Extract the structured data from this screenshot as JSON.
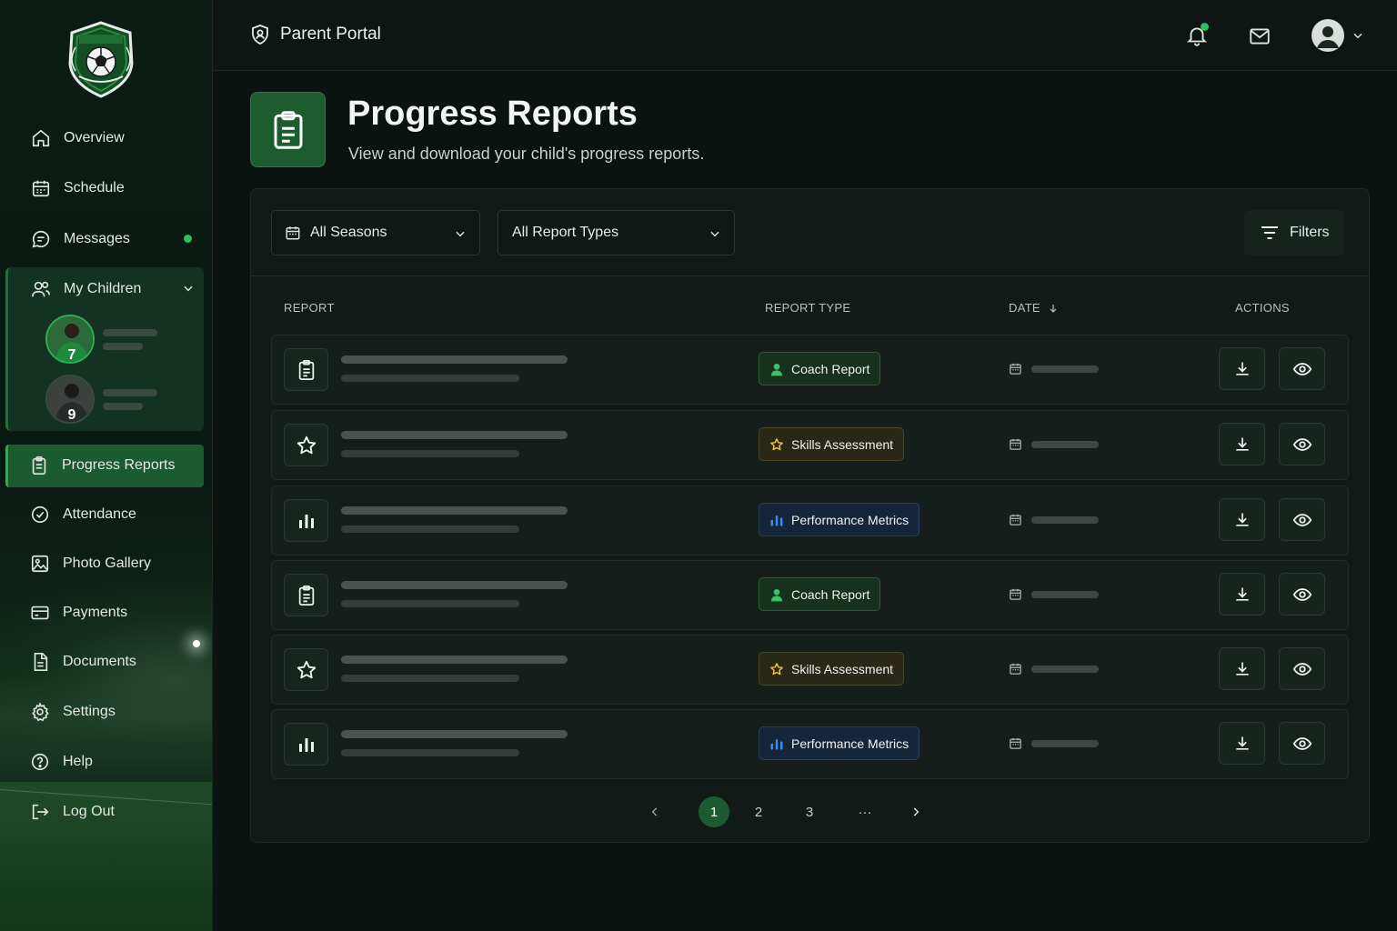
{
  "topbar": {
    "portal_title": "Parent Portal"
  },
  "sidebar": {
    "items": [
      {
        "label": "Overview",
        "icon": "home-icon"
      },
      {
        "label": "Schedule",
        "icon": "calendar-icon"
      },
      {
        "label": "Messages",
        "icon": "chat-icon",
        "has_unread": true
      },
      {
        "label": "My Children",
        "icon": "users-icon",
        "expanded": true
      },
      {
        "label": "Progress Reports",
        "icon": "clipboard-icon",
        "active": true
      },
      {
        "label": "Attendance",
        "icon": "check-circle-icon"
      },
      {
        "label": "Photo Gallery",
        "icon": "image-icon"
      },
      {
        "label": "Payments",
        "icon": "card-icon"
      },
      {
        "label": "Documents",
        "icon": "document-icon"
      },
      {
        "label": "Settings",
        "icon": "gear-icon"
      },
      {
        "label": "Help",
        "icon": "help-circle-icon"
      },
      {
        "label": "Log Out",
        "icon": "logout-icon"
      }
    ],
    "children": [
      {
        "jersey": "7"
      },
      {
        "jersey": "9"
      }
    ]
  },
  "header": {
    "title": "Progress Reports",
    "subtitle": "View and download your child's progress reports."
  },
  "filters": {
    "season": "All Seasons",
    "report_type": "All Report Types",
    "filters_label": "Filters"
  },
  "table": {
    "columns": [
      "REPORT",
      "REPORT TYPE",
      "DATE",
      "ACTIONS"
    ],
    "rows": [
      {
        "icon": "clipboard-icon",
        "type": "Coach Report",
        "variant": "coach"
      },
      {
        "icon": "star-icon",
        "type": "Skills Assessment",
        "variant": "skills"
      },
      {
        "icon": "bar-chart-icon",
        "type": "Performance Metrics",
        "variant": "perf"
      },
      {
        "icon": "clipboard-icon",
        "type": "Coach Report",
        "variant": "coach"
      },
      {
        "icon": "star-icon",
        "type": "Skills Assessment",
        "variant": "skills"
      },
      {
        "icon": "bar-chart-icon",
        "type": "Performance Metrics",
        "variant": "perf"
      }
    ]
  },
  "pagination": {
    "pages": [
      "1",
      "2",
      "3",
      "···"
    ],
    "current": "1"
  },
  "colors": {
    "accent": "#1d5c2f",
    "status_dot": "#2fbf5a",
    "coach_badge": "#16321f",
    "skills_badge": "#2a2716",
    "perf_badge": "#15263a"
  }
}
